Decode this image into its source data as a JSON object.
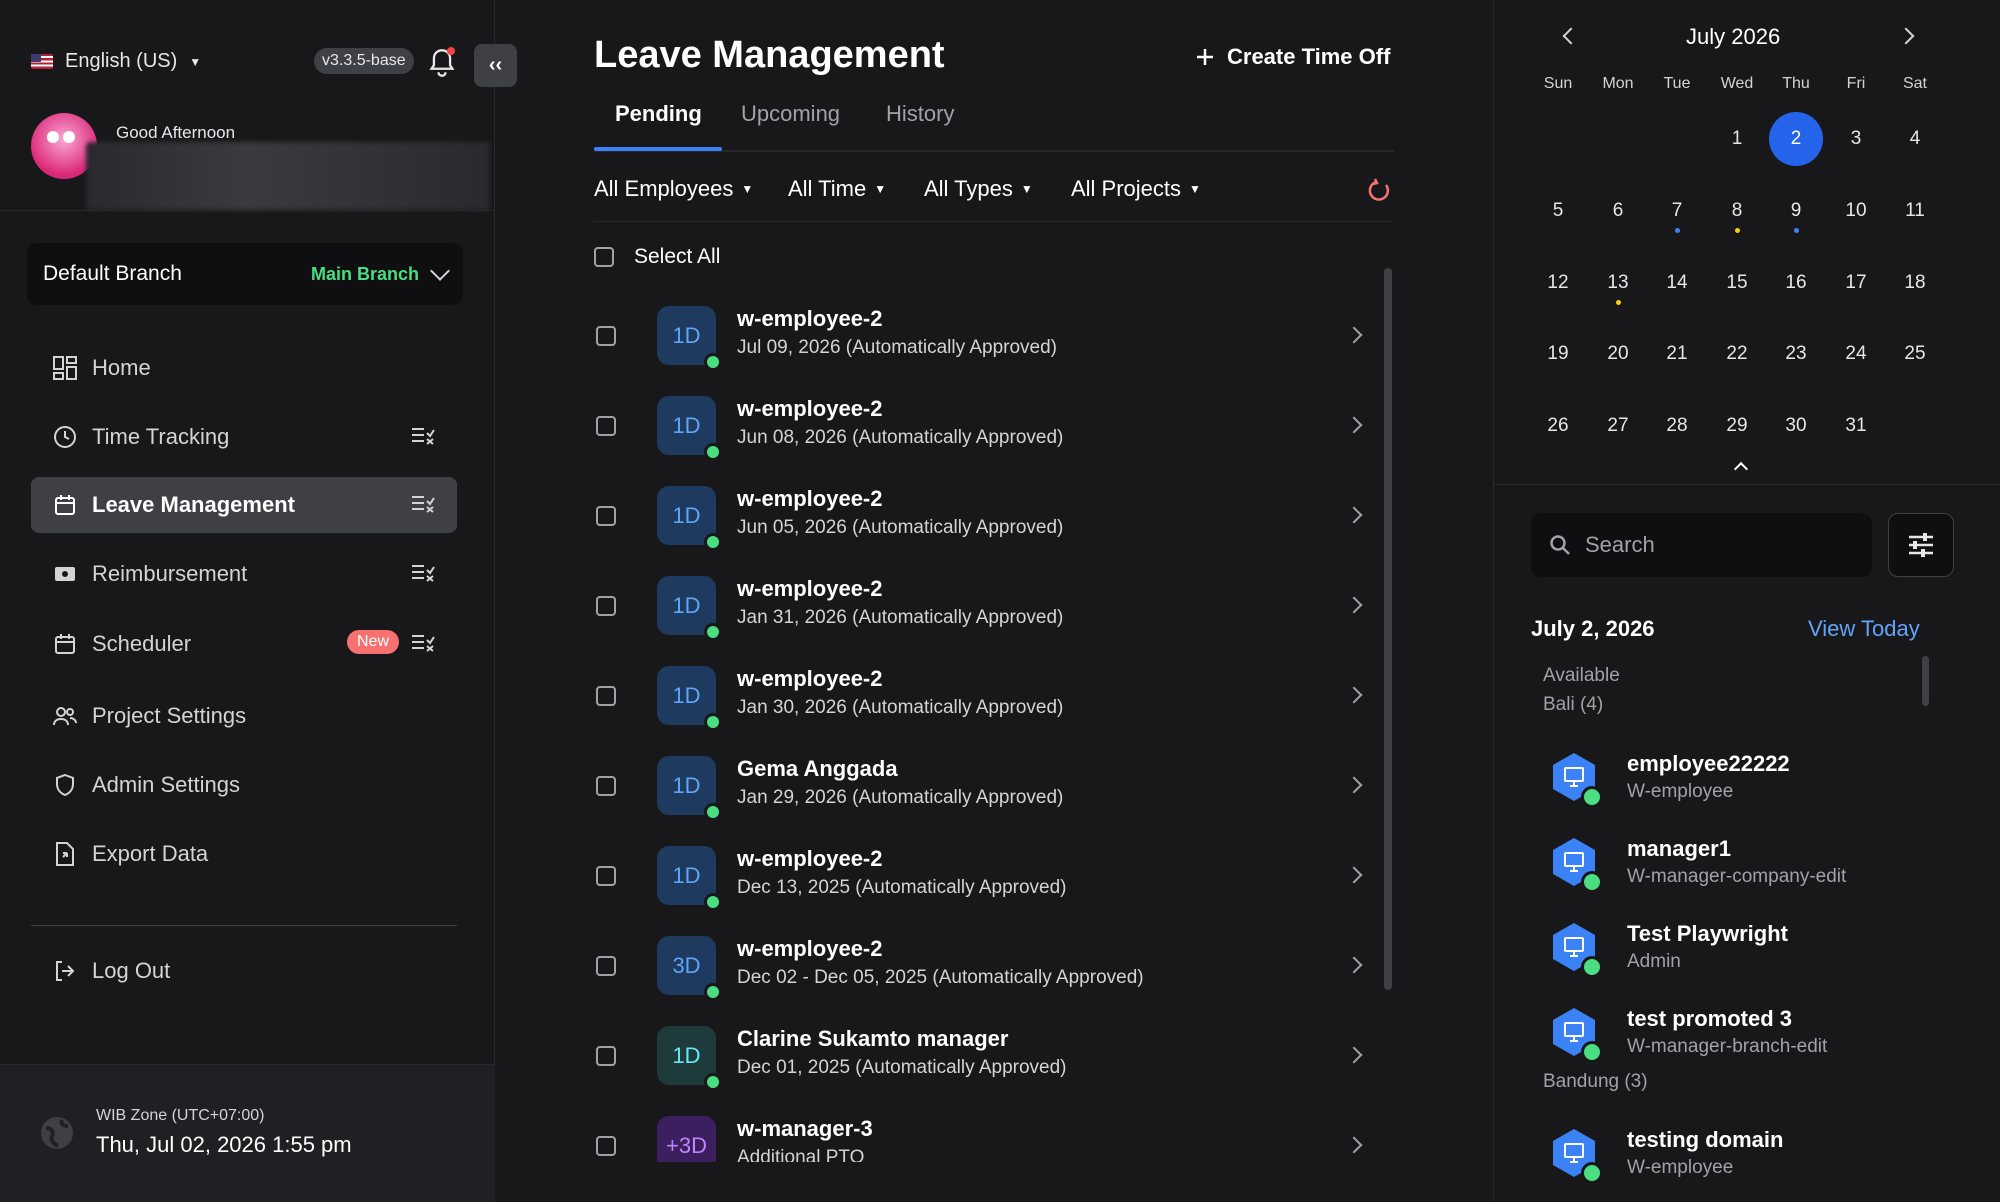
{
  "header": {
    "language": "English (US)",
    "version": "v3.3.5-base",
    "greeting": "Good Afternoon"
  },
  "branch": {
    "label": "Default Branch",
    "value": "Main Branch"
  },
  "sidebar": {
    "items": [
      {
        "label": "Home",
        "icon": "dashboard-icon"
      },
      {
        "label": "Time Tracking",
        "icon": "clock-icon"
      },
      {
        "label": "Leave Management",
        "icon": "calendar-icon"
      },
      {
        "label": "Reimbursement",
        "icon": "receipt-icon"
      },
      {
        "label": "Scheduler",
        "icon": "calendar-icon",
        "badge": "New"
      },
      {
        "label": "Project Settings",
        "icon": "users-icon"
      },
      {
        "label": "Admin Settings",
        "icon": "shield-icon"
      },
      {
        "label": "Export Data",
        "icon": "export-icon"
      }
    ],
    "logout": "Log Out"
  },
  "footer": {
    "zone": "WIB Zone (UTC+07:00)",
    "datetime": "Thu, Jul 02, 2026 1:55 pm"
  },
  "main": {
    "title": "Leave Management",
    "create_label": "Create Time Off",
    "tabs": [
      "Pending",
      "Upcoming",
      "History"
    ],
    "filters": [
      "All Employees",
      "All Time",
      "All Types",
      "All Projects"
    ],
    "select_all": "Select All",
    "requests": [
      {
        "badge": "1D",
        "name": "w-employee-2",
        "detail": "Jul 09, 2026 (Automatically Approved)"
      },
      {
        "badge": "1D",
        "name": "w-employee-2",
        "detail": "Jun 08, 2026 (Automatically Approved)"
      },
      {
        "badge": "1D",
        "name": "w-employee-2",
        "detail": "Jun 05, 2026 (Automatically Approved)"
      },
      {
        "badge": "1D",
        "name": "w-employee-2",
        "detail": "Jan 31, 2026 (Automatically Approved)"
      },
      {
        "badge": "1D",
        "name": "w-employee-2",
        "detail": "Jan 30, 2026 (Automatically Approved)"
      },
      {
        "badge": "1D",
        "name": "Gema Anggada",
        "detail": "Jan 29, 2026 (Automatically Approved)"
      },
      {
        "badge": "1D",
        "name": "w-employee-2",
        "detail": "Dec 13, 2025 (Automatically Approved)"
      },
      {
        "badge": "3D",
        "name": "w-employee-2",
        "detail": "Dec 02 - Dec 05, 2025 (Automatically Approved)"
      },
      {
        "badge": "1D",
        "name": "Clarine Sukamto manager",
        "detail": "Dec 01, 2025 (Automatically Approved)"
      },
      {
        "badge": "+3D",
        "name": "w-manager-3",
        "detail": "Additional PTO"
      }
    ]
  },
  "calendar": {
    "month_label": "July 2026",
    "weekdays": [
      "Sun",
      "Mon",
      "Tue",
      "Wed",
      "Thu",
      "Fri",
      "Sat"
    ],
    "days": [
      "1",
      "2",
      "3",
      "4",
      "5",
      "6",
      "7",
      "8",
      "9",
      "10",
      "11",
      "12",
      "13",
      "14",
      "15",
      "16",
      "17",
      "18",
      "19",
      "20",
      "21",
      "22",
      "23",
      "24",
      "25",
      "26",
      "27",
      "28",
      "29",
      "30",
      "31"
    ],
    "selected_day": "2"
  },
  "panel": {
    "search_placeholder": "Search",
    "date_label": "July 2, 2026",
    "view_today": "View Today",
    "available": "Available",
    "groups": [
      {
        "name": "Bali (4)",
        "people": [
          {
            "name": "employee22222",
            "role": "W-employee"
          },
          {
            "name": "manager1",
            "role": "W-manager-company-edit"
          },
          {
            "name": "Test Playwright",
            "role": "Admin"
          },
          {
            "name": "test promoted 3",
            "role": "W-manager-branch-edit"
          }
        ]
      },
      {
        "name": "Bandung (3)",
        "people": [
          {
            "name": "testing domain",
            "role": "W-employee"
          }
        ]
      }
    ]
  },
  "colors": {
    "accent": "#3b82f6",
    "success": "#4ade80",
    "badge_new": "#f87171",
    "refresh": "#f87171"
  }
}
